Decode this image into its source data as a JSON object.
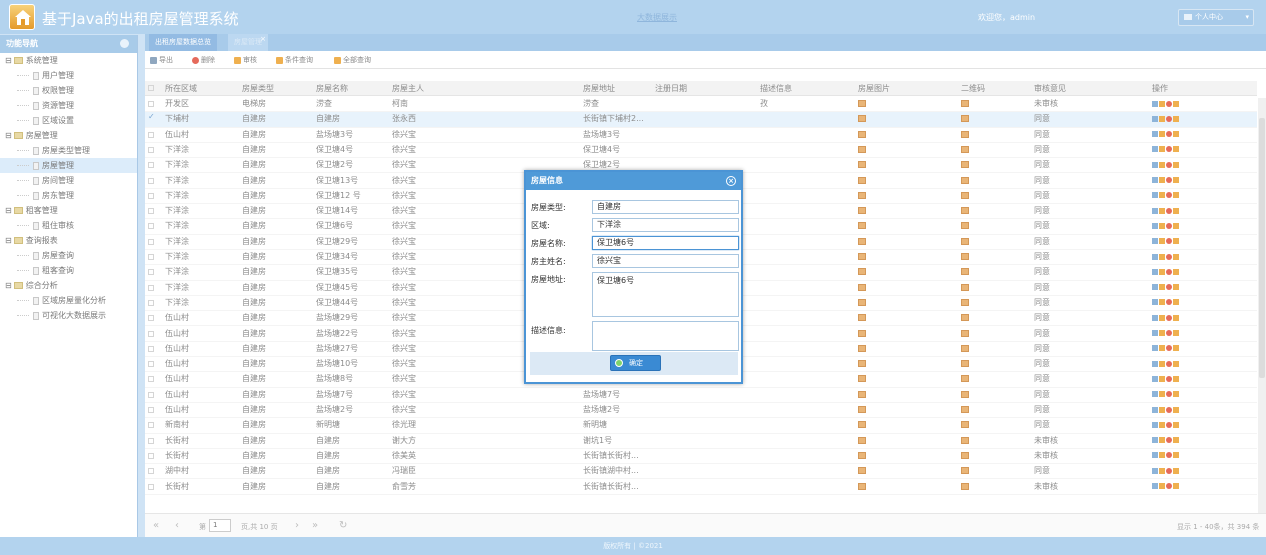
{
  "app": {
    "title": "基于Java的出租房屋管理系统",
    "top_link": "大数据展示",
    "welcome": "欢迎您，admin",
    "user_menu": "个人中心"
  },
  "sidebar": {
    "title": "功能导航",
    "groups": [
      {
        "label": "系统管理",
        "items": [
          "用户管理",
          "权限管理",
          "资源管理",
          "区域设置"
        ]
      },
      {
        "label": "房屋管理",
        "items": [
          "房屋类型管理",
          "房屋管理",
          "房间管理",
          "房东管理"
        ]
      },
      {
        "label": "租客管理",
        "items": [
          "租住审核"
        ]
      },
      {
        "label": "查询报表",
        "items": [
          "房屋查询",
          "租客查询"
        ]
      },
      {
        "label": "综合分析",
        "items": [
          "区域房屋量化分析",
          "可视化大数据展示"
        ]
      }
    ]
  },
  "tabs": [
    {
      "label": "出租房屋数据总览"
    },
    {
      "label": "房屋管理"
    }
  ],
  "toolbar": {
    "export": "导出",
    "delete": "删除",
    "audit": "审核",
    "filter": "条件查询",
    "all": "全部查询"
  },
  "columns": [
    "所在区域",
    "房屋类型",
    "房屋名称",
    "房屋主人",
    "房屋地址",
    "注册日期",
    "描述信息",
    "房屋图片",
    "二维码",
    "审核意见",
    "操作"
  ],
  "rows": [
    [
      "开发区",
      "电梯房",
      "涝查",
      "柯南",
      "涝查",
      "",
      "孜",
      "未审核"
    ],
    [
      "下埔村",
      "自建房",
      "自建房",
      "张永西",
      "长街镇下埔村2...",
      "",
      "",
      "同意"
    ],
    [
      "伍山村",
      "自建房",
      "盐场塘3号",
      "徐兴宝",
      "盐场塘3号",
      "",
      "",
      "同意"
    ],
    [
      "下洋涂",
      "自建房",
      "保卫塘4号",
      "徐兴宝",
      "保卫塘4号",
      "",
      "",
      "同意"
    ],
    [
      "下洋涂",
      "自建房",
      "保卫塘2号",
      "徐兴宝",
      "保卫塘2号",
      "",
      "",
      "同意"
    ],
    [
      "下洋涂",
      "自建房",
      "保卫塘13号",
      "徐兴宝",
      "",
      "",
      "",
      "同意"
    ],
    [
      "下洋涂",
      "自建房",
      "保卫塘12 号",
      "徐兴宝",
      "",
      "",
      "",
      "同意"
    ],
    [
      "下洋涂",
      "自建房",
      "保卫塘14号",
      "徐兴宝",
      "",
      "",
      "",
      "同意"
    ],
    [
      "下洋涂",
      "自建房",
      "保卫塘6号",
      "徐兴宝",
      "",
      "",
      "",
      "同意"
    ],
    [
      "下洋涂",
      "自建房",
      "保卫塘29号",
      "徐兴宝",
      "",
      "",
      "",
      "同意"
    ],
    [
      "下洋涂",
      "自建房",
      "保卫塘34号",
      "徐兴宝",
      "",
      "",
      "",
      "同意"
    ],
    [
      "下洋涂",
      "自建房",
      "保卫塘35号",
      "徐兴宝",
      "",
      "",
      "",
      "同意"
    ],
    [
      "下洋涂",
      "自建房",
      "保卫塘45号",
      "徐兴宝",
      "",
      "",
      "",
      "同意"
    ],
    [
      "下洋涂",
      "自建房",
      "保卫塘44号",
      "徐兴宝",
      "",
      "",
      "",
      "同意"
    ],
    [
      "伍山村",
      "自建房",
      "盐场塘29号",
      "徐兴宝",
      "",
      "",
      "",
      "同意"
    ],
    [
      "伍山村",
      "自建房",
      "盐场塘22号",
      "徐兴宝",
      "",
      "",
      "",
      "同意"
    ],
    [
      "伍山村",
      "自建房",
      "盐场塘27号",
      "徐兴宝",
      "",
      "",
      "",
      "同意"
    ],
    [
      "伍山村",
      "自建房",
      "盐场塘10号",
      "徐兴宝",
      "",
      "",
      "",
      "同意"
    ],
    [
      "伍山村",
      "自建房",
      "盐场塘8号",
      "徐兴宝",
      "盐场塘8号",
      "",
      "",
      "同意"
    ],
    [
      "伍山村",
      "自建房",
      "盐场塘7号",
      "徐兴宝",
      "盐场塘7号",
      "",
      "",
      "同意"
    ],
    [
      "伍山村",
      "自建房",
      "盐场塘2号",
      "徐兴宝",
      "盐场塘2号",
      "",
      "",
      "同意"
    ],
    [
      "新南村",
      "自建房",
      "新明塘",
      "徐光理",
      "新明塘",
      "",
      "",
      "同意"
    ],
    [
      "长街村",
      "自建房",
      "自建房",
      "谢大方",
      "谢坑1号",
      "",
      "",
      "未审核"
    ],
    [
      "长街村",
      "自建房",
      "自建房",
      "徐美英",
      "长街镇长街村...",
      "",
      "",
      "未审核"
    ],
    [
      "湖中村",
      "自建房",
      "自建房",
      "冯瑞臣",
      "长街镇湖中村...",
      "",
      "",
      "同意"
    ],
    [
      "长街村",
      "自建房",
      "自建房",
      "俞雪芳",
      "长街镇长街村...",
      "",
      "",
      "未审核"
    ]
  ],
  "pager": {
    "page_label": "第",
    "page_value": "1",
    "of_pages": "页,共 10 页",
    "summary": "显示 1 - 40条，共 394 条"
  },
  "footer": "版权所有 | ©2021",
  "dialog": {
    "title": "房屋信息",
    "type_label": "房屋类型:",
    "type_value": "自建房",
    "region_label": "区域:",
    "region_value": "下洋涂",
    "name_label": "房屋名称:",
    "name_value": "保卫塘6号",
    "owner_label": "房主姓名:",
    "owner_value": "徐兴宝",
    "address_label": "房屋地址:",
    "address_value": "保卫塘6号",
    "desc_label": "描述信息:",
    "desc_value": "",
    "ok": "确定"
  }
}
